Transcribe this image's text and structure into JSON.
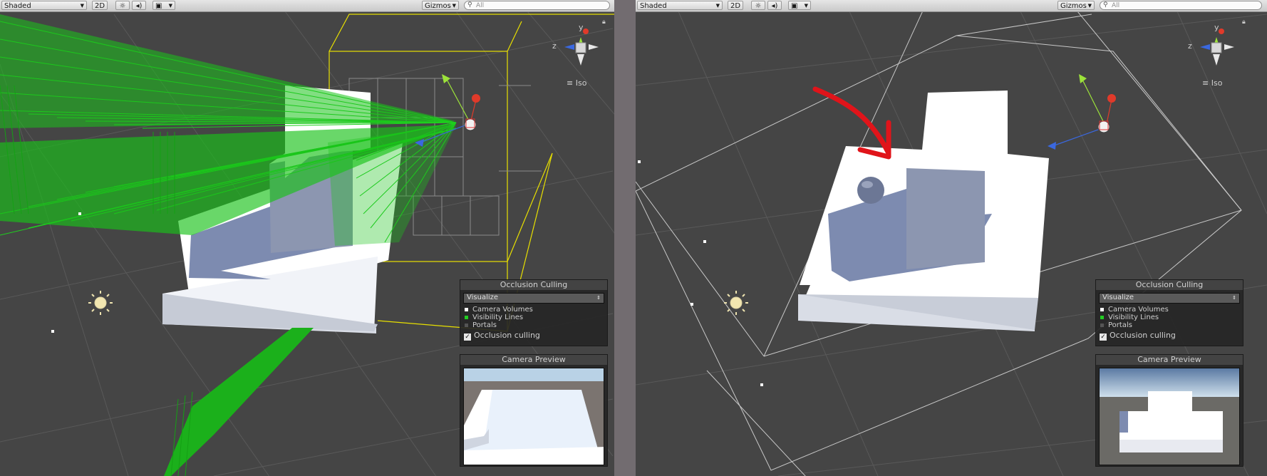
{
  "left": {
    "toolbar": {
      "mode": "Shaded",
      "two_d": "2D",
      "light_icon": "sun-icon",
      "audio_icon": "speaker-icon",
      "fx_icon": "image-icon",
      "gizmos": "Gizmos",
      "search_placeholder": "All"
    },
    "gizmo": {
      "y": "y",
      "z": "z",
      "iso": "Iso"
    },
    "occlusion": {
      "title": "Occlusion Culling",
      "mode": "Visualize",
      "legend": [
        {
          "label": "Camera Volumes",
          "color": "#ffffff"
        },
        {
          "label": "Visibility Lines",
          "color": "#22cc22"
        },
        {
          "label": "Portals",
          "color": "#555555"
        }
      ],
      "checkbox_label": "Occlusion culling",
      "checked": true
    },
    "camera_preview": {
      "title": "Camera Preview"
    }
  },
  "right": {
    "toolbar": {
      "mode": "Shaded",
      "two_d": "2D",
      "light_icon": "sun-icon",
      "audio_icon": "speaker-icon",
      "fx_icon": "image-icon",
      "gizmos": "Gizmos",
      "search_placeholder": "All"
    },
    "gizmo": {
      "y": "y",
      "z": "z",
      "iso": "Iso"
    },
    "occlusion": {
      "title": "Occlusion Culling",
      "mode": "Visualize",
      "legend": [
        {
          "label": "Camera Volumes",
          "color": "#ffffff"
        },
        {
          "label": "Visibility Lines",
          "color": "#22cc22"
        },
        {
          "label": "Portals",
          "color": "#555555"
        }
      ],
      "checkbox_label": "Occlusion culling",
      "checked": true
    },
    "camera_preview": {
      "title": "Camera Preview"
    }
  },
  "colors": {
    "viewport_bg": "#454545",
    "grid": "#5a5a5a",
    "visibility_lines": "#22cc22",
    "volume_bounds": "#e8e000",
    "annotation_arrow": "#e0141a"
  }
}
